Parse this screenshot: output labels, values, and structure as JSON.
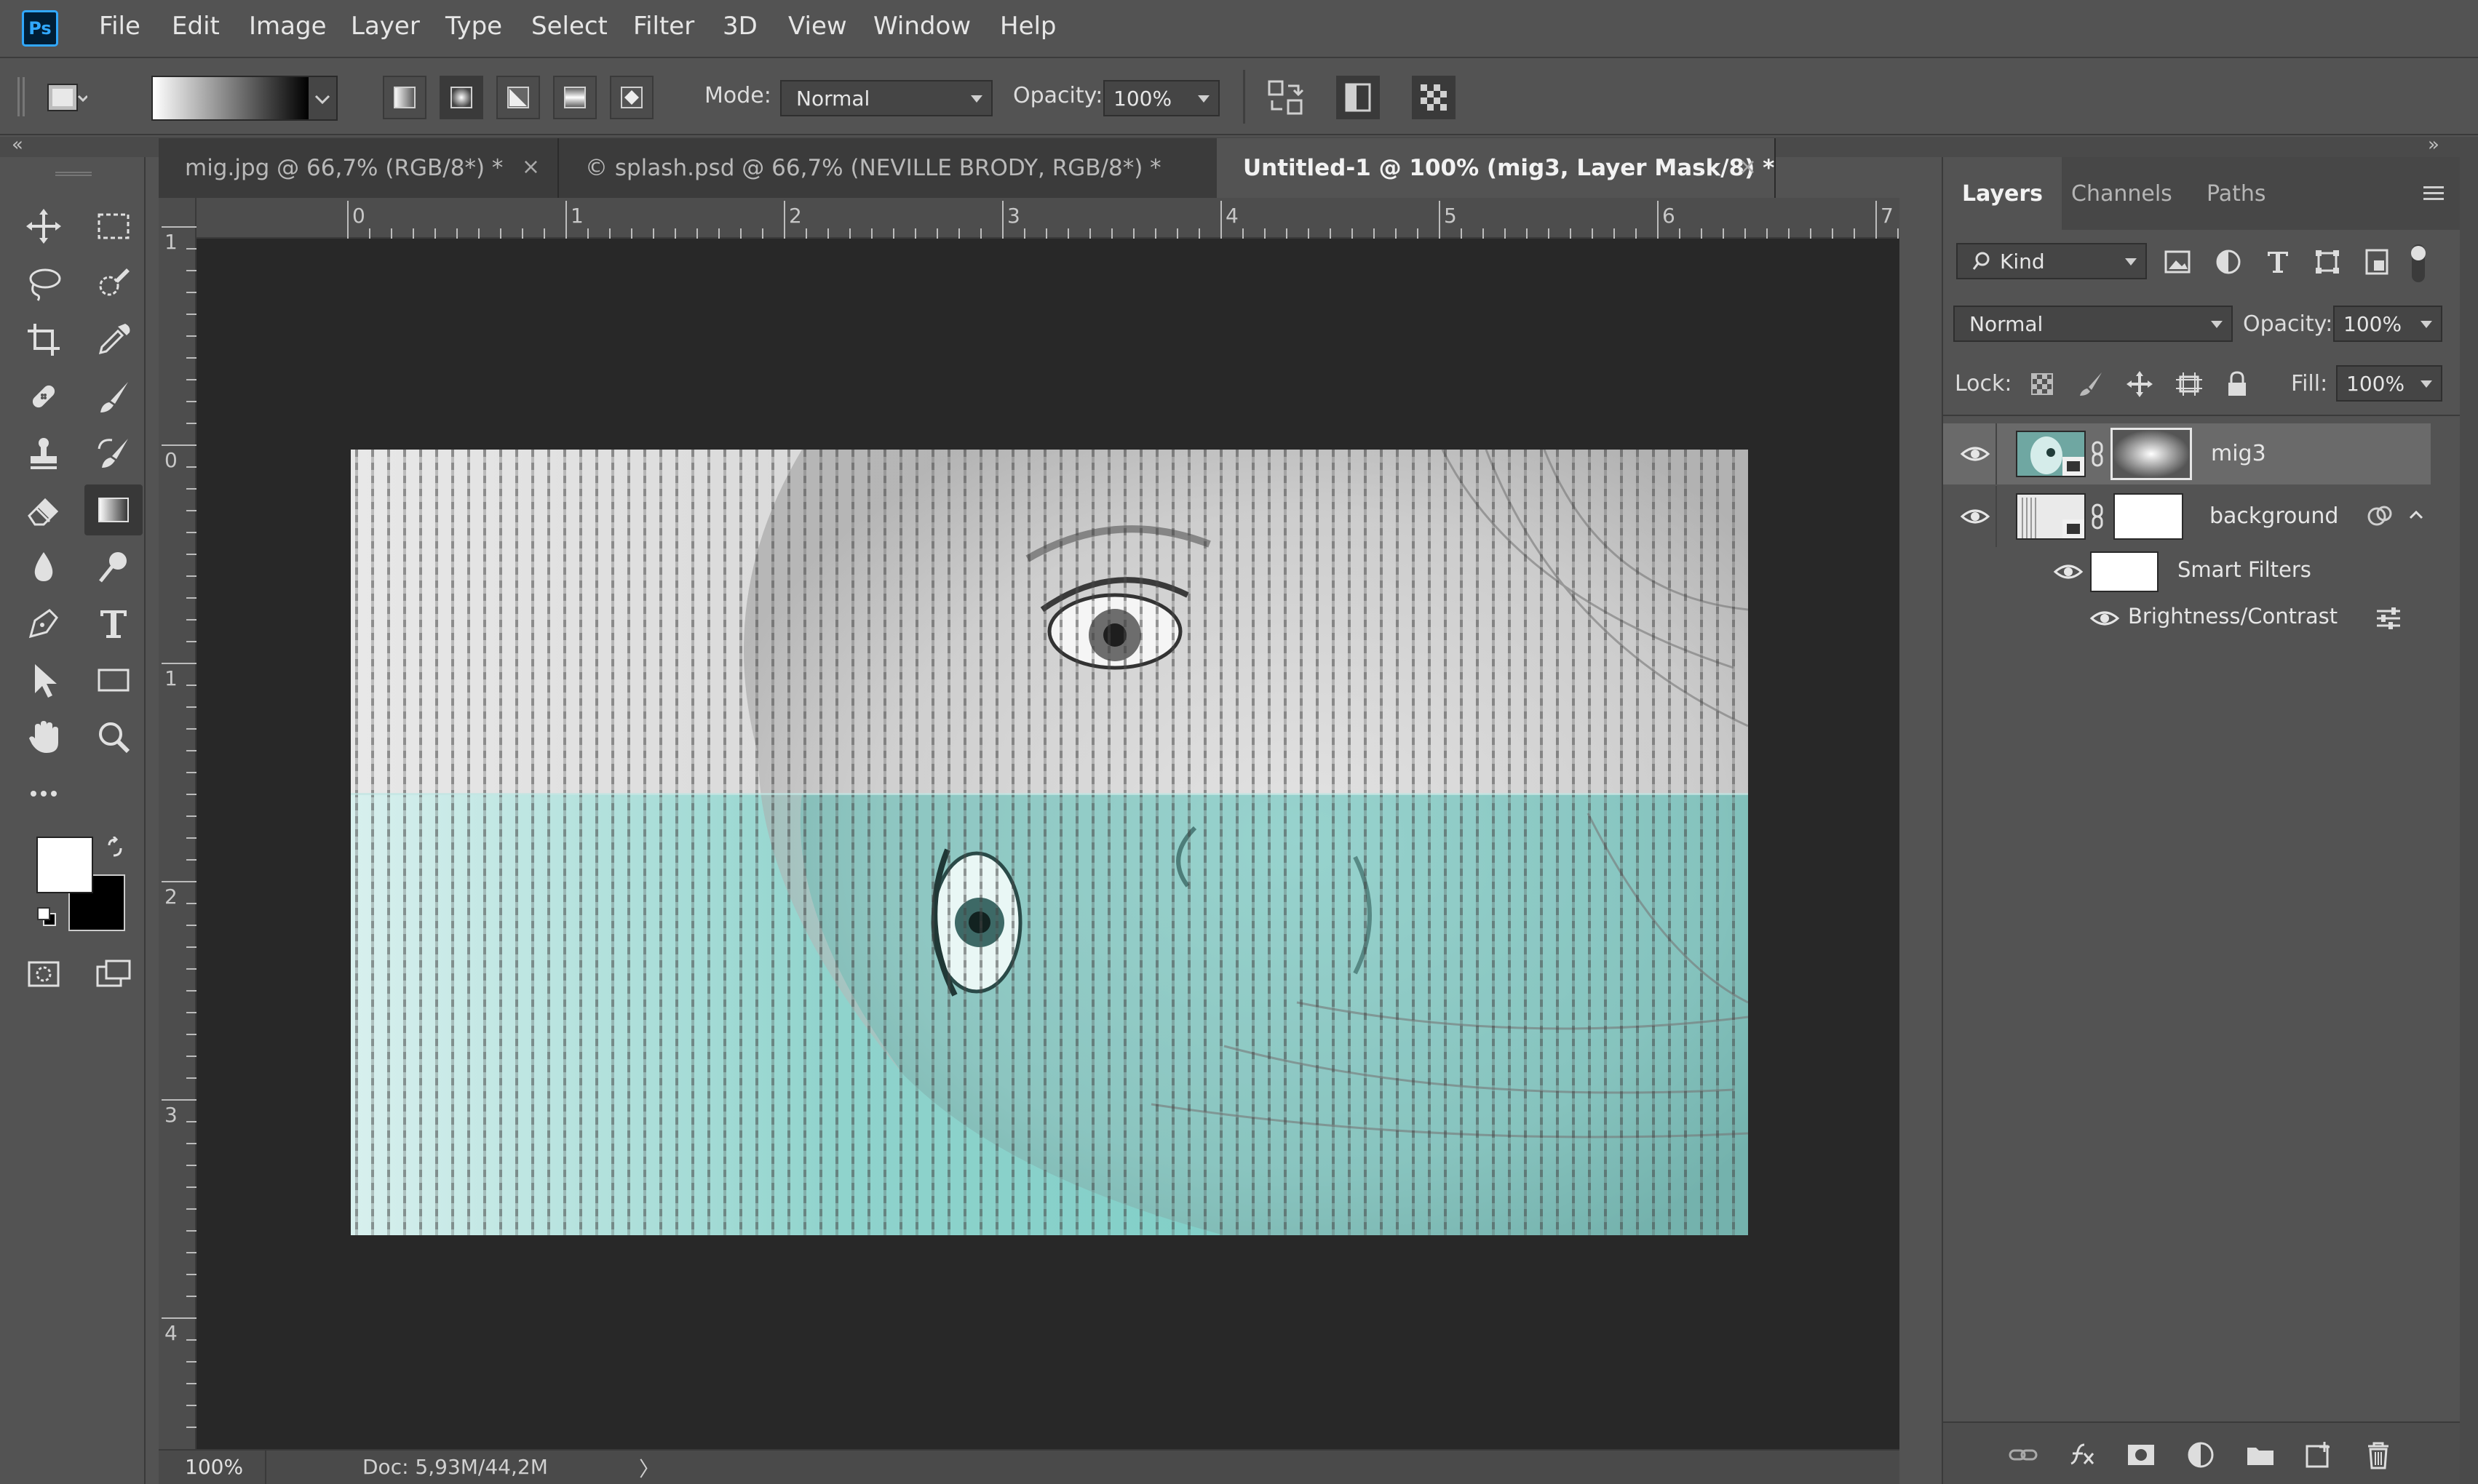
{
  "app": {
    "logo": "Ps"
  },
  "menu": [
    "File",
    "Edit",
    "Image",
    "Layer",
    "Type",
    "Select",
    "Filter",
    "3D",
    "View",
    "Window",
    "Help"
  ],
  "options": {
    "mode_label": "Mode:",
    "mode_value": "Normal",
    "opacity_label": "Opacity:",
    "opacity_value": "100%"
  },
  "tabs": [
    {
      "label": "mig.jpg @ 66,7% (RGB/8*) *",
      "active": false
    },
    {
      "label": "© splash.psd @ 66,7% (NEVILLE BRODY, RGB/8*) *",
      "active": false
    },
    {
      "label": "Untitled-1 @ 100% (mig3, Layer Mask/8) *",
      "active": true
    }
  ],
  "tab_close": "×",
  "ruler": {
    "horizontal": [
      "0",
      "1",
      "2",
      "3",
      "4",
      "5",
      "6",
      "7"
    ],
    "vertical": [
      "1",
      "0",
      "1",
      "2",
      "3",
      "4"
    ]
  },
  "status": {
    "zoom": "100%",
    "doc": "Doc: 5,93M/44,2M",
    "arrow": "〉"
  },
  "layers_panel": {
    "tabs": [
      "Layers",
      "Channels",
      "Paths"
    ],
    "filter_kind": "Kind",
    "blend_mode": "Normal",
    "opacity_label": "Opacity:",
    "opacity_value": "100%",
    "lock_label": "Lock:",
    "fill_label": "Fill:",
    "fill_value": "100%",
    "layers": [
      {
        "name": "mig3",
        "visible": true,
        "selected": true
      },
      {
        "name": "background",
        "visible": true,
        "selected": false
      }
    ],
    "smart_filters": "Smart Filters",
    "filter_item": "Brightness/Contrast"
  },
  "colors": {
    "accent": "#31a8ff",
    "panel_bg": "#535353",
    "canvas_bg": "#282828",
    "teal_tint": "#6fc9c2"
  },
  "icons": {
    "toolbar": [
      "move-icon",
      "marquee-icon",
      "lasso-icon",
      "quick-select-icon",
      "crop-icon",
      "eyedropper-icon",
      "healing-icon",
      "brush-icon",
      "stamp-icon",
      "history-brush-icon",
      "eraser-icon",
      "gradient-icon",
      "blur-icon",
      "dodge-icon",
      "pen-icon",
      "type-icon",
      "path-select-icon",
      "rectangle-icon",
      "hand-icon",
      "zoom-icon",
      "more-icon"
    ]
  }
}
